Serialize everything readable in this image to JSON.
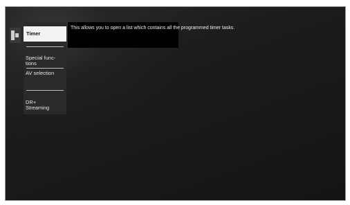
{
  "menu": {
    "items": [
      {
        "label": "Timer"
      },
      {
        "label": "Special func-\ntions"
      },
      {
        "label": "AV selection"
      },
      {
        "label": "DR+\nStreaming"
      }
    ]
  },
  "description": {
    "text": "This allows you to open a list which contains all the programmed timer tasks."
  },
  "colors": {
    "background": "#1c1c1c",
    "menu_background": "#2a2a2a",
    "selected_item": "#f2f2f2",
    "text": "#e6e6e6"
  },
  "icons": {
    "side": "menu-panel-icon"
  }
}
